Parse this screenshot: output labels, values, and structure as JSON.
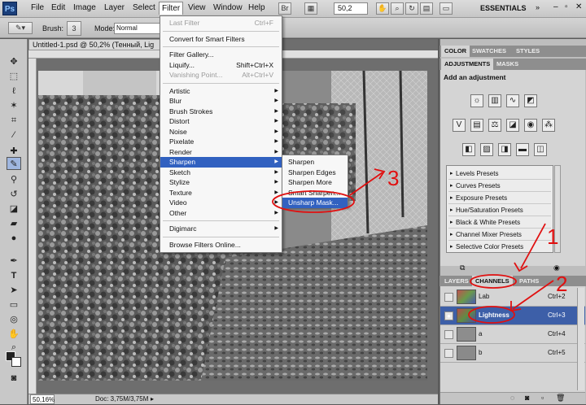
{
  "app": {
    "logo": "Ps",
    "zoom": "50,2",
    "workspace": "ESSENTIALS"
  },
  "menubar": [
    "File",
    "Edit",
    "Image",
    "Layer",
    "Select",
    "Filter",
    "View",
    "Window",
    "Help"
  ],
  "options": {
    "brush_label": "Brush:",
    "brush_size": "3",
    "mode_label": "Mode:",
    "mode_value": "Normal"
  },
  "document": {
    "tab_title": "Untitled-1.psd @ 50,2% (Тенный, Lig",
    "zoom_status": "50,16%",
    "doc_size": "Doc: 3,75M/3,75M"
  },
  "filter_menu": {
    "items": [
      {
        "label": "Last Filter",
        "shortcut": "Ctrl+F",
        "disabled": true
      },
      {
        "sep": true
      },
      {
        "label": "Convert for Smart Filters"
      },
      {
        "sep": true
      },
      {
        "label": "Filter Gallery..."
      },
      {
        "label": "Liquify...",
        "shortcut": "Shift+Ctrl+X"
      },
      {
        "label": "Vanishing Point...",
        "shortcut": "Alt+Ctrl+V",
        "disabled": true
      },
      {
        "sep": true
      },
      {
        "label": "Artistic",
        "submenu": true
      },
      {
        "label": "Blur",
        "submenu": true
      },
      {
        "label": "Brush Strokes",
        "submenu": true
      },
      {
        "label": "Distort",
        "submenu": true
      },
      {
        "label": "Noise",
        "submenu": true
      },
      {
        "label": "Pixelate",
        "submenu": true
      },
      {
        "label": "Render",
        "submenu": true
      },
      {
        "label": "Sharpen",
        "submenu": true,
        "highlighted": true
      },
      {
        "label": "Sketch",
        "submenu": true
      },
      {
        "label": "Stylize",
        "submenu": true
      },
      {
        "label": "Texture",
        "submenu": true
      },
      {
        "label": "Video",
        "submenu": true
      },
      {
        "label": "Other",
        "submenu": true
      },
      {
        "sep": true
      },
      {
        "label": "Digimarc",
        "submenu": true
      },
      {
        "sep": true
      },
      {
        "label": "Browse Filters Online..."
      }
    ]
  },
  "sharpen_submenu": [
    "Sharpen",
    "Sharpen Edges",
    "Sharpen More",
    "Smart Sharpen...",
    "Unsharp Mask..."
  ],
  "panels": {
    "top_tabs": [
      "COLOR",
      "SWATCHES",
      "STYLES"
    ],
    "adj_tabs": [
      "ADJUSTMENTS",
      "MASKS"
    ],
    "adj_title": "Add an adjustment",
    "presets": [
      "Levels Presets",
      "Curves Presets",
      "Exposure Presets",
      "Hue/Saturation Presets",
      "Black & White Presets",
      "Channel Mixer Presets",
      "Selective Color Presets"
    ],
    "layer_tabs": [
      "LAYERS",
      "CHANNELS",
      "PATHS"
    ],
    "channels": [
      {
        "name": "Lab",
        "shortcut": "Ctrl+2"
      },
      {
        "name": "Lightness",
        "shortcut": "Ctrl+3"
      },
      {
        "name": "a",
        "shortcut": "Ctrl+4"
      },
      {
        "name": "b",
        "shortcut": "Ctrl+5"
      }
    ]
  },
  "annotations": [
    "1",
    "2",
    "3"
  ]
}
